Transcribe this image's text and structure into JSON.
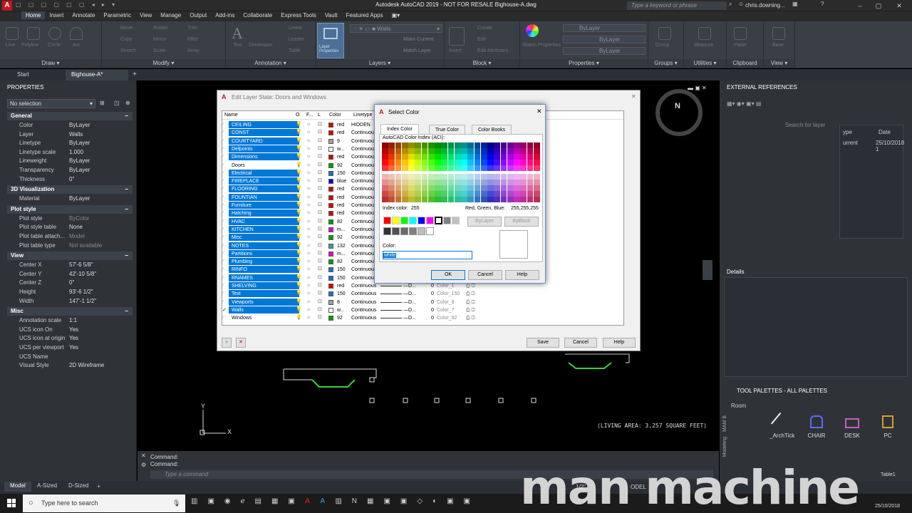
{
  "title_bar": {
    "title": "Autodesk AutoCAD 2019 - NOT FOR RESALE   Bighouse-A.dwg",
    "search_placeholder": "Type a keyword or phrase",
    "user": "chris.downing..."
  },
  "menu": [
    "Home",
    "Insert",
    "Annotate",
    "Parametric",
    "View",
    "Manage",
    "Output",
    "Add-ins",
    "Collaborate",
    "Express Tools",
    "Vault",
    "Featured Apps"
  ],
  "ribbon": {
    "draw": {
      "label": "Draw",
      "tools": [
        "Line",
        "Polyline",
        "Circle",
        "Arc"
      ]
    },
    "modify": {
      "label": "Modify",
      "tools": [
        "Move",
        "Rotate",
        "Trim",
        "Copy",
        "Mirror",
        "Fillet",
        "Stretch",
        "Scale",
        "Array"
      ]
    },
    "annotation": {
      "label": "Annotation",
      "tools": [
        "Text",
        "Dimension",
        "Linear",
        "Leader",
        "Table"
      ]
    },
    "layers": {
      "label": "Layers",
      "current_layer": "Walls",
      "tools": [
        "Layer Properties"
      ]
    },
    "block": {
      "label": "Block",
      "tools": [
        "Create",
        "Edit",
        "Edit Attributes",
        "Insert",
        "Make Current",
        "Match Layer"
      ]
    },
    "properties": {
      "label": "Properties",
      "color": "ByLayer",
      "linetype": "ByLayer",
      "lineweight": "ByLayer",
      "tools": [
        "Match Properties"
      ]
    },
    "groups": {
      "label": "Groups",
      "tools": [
        "Group"
      ]
    },
    "utilities": {
      "label": "Utilities",
      "tools": [
        "Measure"
      ]
    },
    "clipboard": {
      "label": "Clipboard",
      "tools": [
        "Paste"
      ]
    },
    "view": {
      "label": "View",
      "tools": [
        "Base"
      ]
    }
  },
  "doc_tabs": {
    "start": "Start",
    "active": "Bighouse-A*"
  },
  "properties_panel": {
    "title": "PROPERTIES",
    "selection": "No selection",
    "general": {
      "heading": "General",
      "rows": [
        [
          "Color",
          "ByLayer"
        ],
        [
          "Layer",
          "Walls"
        ],
        [
          "Linetype",
          "ByLayer"
        ],
        [
          "Linetype scale",
          "1.000"
        ],
        [
          "Lineweight",
          "ByLayer"
        ],
        [
          "Transparency",
          "ByLayer"
        ],
        [
          "Thickness",
          "0\""
        ]
      ]
    },
    "viz": {
      "heading": "3D Visualization",
      "rows": [
        [
          "Material",
          "ByLayer"
        ]
      ]
    },
    "plot": {
      "heading": "Plot style",
      "rows": [
        [
          "Plot style",
          "ByColor"
        ],
        [
          "Plot style table",
          "None"
        ],
        [
          "Plot table attach...",
          "Model"
        ],
        [
          "Plot table type",
          "Not available"
        ]
      ]
    },
    "view": {
      "heading": "View",
      "rows": [
        [
          "Center X",
          "57'-6 5/8\""
        ],
        [
          "Center Y",
          "42'-10 5/8\""
        ],
        [
          "Center Z",
          "0\""
        ],
        [
          "Height",
          "93'-6 1/2\""
        ],
        [
          "Width",
          "147'-1 1/2\""
        ]
      ]
    },
    "misc": {
      "heading": "Misc",
      "rows": [
        [
          "Annotation scale",
          "1:1"
        ],
        [
          "UCS icon On",
          "Yes"
        ],
        [
          "UCS icon at origin",
          "Yes"
        ],
        [
          "UCS per viewport",
          "Yes"
        ],
        [
          "UCS Name",
          ""
        ],
        [
          "Visual Style",
          "2D Wireframe"
        ]
      ]
    }
  },
  "canvas": {
    "compass": "N",
    "living_area": "(LIVING AREA: 3,257 SQUARE FEET)",
    "axis_x": "X",
    "axis_y": "Y"
  },
  "command": {
    "line1": "Command:",
    "line2": "Command:",
    "placeholder": "Type a command"
  },
  "layer_state_dialog": {
    "title": "Edit Layer State: Doors and Windows",
    "columns": {
      "name": "Name",
      "on": "O",
      "freeze": "F...",
      "lock": "L",
      "color": "Color",
      "linetype": "Linetype"
    },
    "rows": [
      {
        "name": "CEILING",
        "color": "#e00000",
        "cname": "red",
        "lt": "HIDDEN",
        "sel": true
      },
      {
        "name": "CONST",
        "color": "#e00000",
        "cname": "red",
        "lt": "Continuous",
        "sel": true
      },
      {
        "name": "COURTYARD",
        "color": "#a0a0a0",
        "cname": "9",
        "lt": "Continuous",
        "sel": true
      },
      {
        "name": "Defpoints",
        "color": "#ffffff",
        "cname": "w...",
        "lt": "Continuous",
        "sel": true
      },
      {
        "name": "Dimensions",
        "color": "#e00000",
        "cname": "red",
        "lt": "Continuous",
        "sel": true
      },
      {
        "name": "Doors",
        "color": "#00a000",
        "cname": "92",
        "lt": "Continuous",
        "sel": false
      },
      {
        "name": "Electrical",
        "color": "#1e70d0",
        "cname": "150",
        "lt": "Continuous",
        "sel": true
      },
      {
        "name": "FIREPLACE",
        "color": "#0000e0",
        "cname": "blue",
        "lt": "Continuous",
        "sel": true
      },
      {
        "name": "FLOORING",
        "color": "#e00000",
        "cname": "red",
        "lt": "Continuous",
        "sel": true
      },
      {
        "name": "FOUNTIAN",
        "color": "#e00000",
        "cname": "red",
        "lt": "Continuous",
        "sel": true
      },
      {
        "name": "Furniture",
        "color": "#e00000",
        "cname": "red",
        "lt": "Continuous",
        "sel": true
      },
      {
        "name": "Hatching",
        "color": "#e00000",
        "cname": "red",
        "lt": "Continuous",
        "sel": true
      },
      {
        "name": "HVAC",
        "color": "#00a000",
        "cname": "82",
        "lt": "Continuous",
        "sel": true
      },
      {
        "name": "KITCHEN",
        "color": "#e000e0",
        "cname": "m...",
        "lt": "Continuous",
        "sel": true
      },
      {
        "name": "Misc",
        "color": "#00a000",
        "cname": "92",
        "lt": "Continuous",
        "sel": true
      },
      {
        "name": "NOTES",
        "color": "#3aa0a0",
        "cname": "132",
        "lt": "Continuous",
        "sel": true
      },
      {
        "name": "Partitions",
        "color": "#e000e0",
        "cname": "m...",
        "lt": "Continuous",
        "sel": true
      },
      {
        "name": "Plumbing",
        "color": "#00a000",
        "cname": "82",
        "lt": "Continuous",
        "sel": true
      },
      {
        "name": "RINFO",
        "color": "#1e70d0",
        "cname": "150",
        "lt": "Continuous",
        "sel": true
      },
      {
        "name": "RNAMES",
        "color": "#1e70d0",
        "cname": "150",
        "lt": "Continuous",
        "sel": true
      },
      {
        "name": "SHELVING",
        "color": "#e00000",
        "cname": "red",
        "lt": "Continuous",
        "sel": true
      },
      {
        "name": "Text",
        "color": "#1e70d0",
        "cname": "150",
        "lt": "Continuous",
        "sel": true
      },
      {
        "name": "Viewports",
        "color": "#a0a0a0",
        "cname": "8",
        "lt": "Continuous",
        "sel": true
      },
      {
        "name": "Walls",
        "color": "#ffffff",
        "cname": "w...",
        "lt": "Continuous",
        "sel": true
      },
      {
        "name": "Windows",
        "color": "#00a000",
        "cname": "92",
        "lt": "Continuous",
        "sel": false
      }
    ],
    "extra_rows": [
      [
        "0",
        "Color_1"
      ],
      [
        "0",
        "Color_150"
      ],
      [
        "0",
        "Color_8"
      ],
      [
        "0",
        "Color_7"
      ],
      [
        "0",
        "Color_92"
      ]
    ],
    "buttons": {
      "save": "Save",
      "cancel": "Cancel",
      "help": "Help"
    }
  },
  "select_color_dialog": {
    "title": "Select Color",
    "tabs": [
      "Index Color",
      "True Color",
      "Color Books"
    ],
    "aci_label": "AutoCAD Color Index (ACI):",
    "index_color_label": "Index color:",
    "index_color_value": "255",
    "rgb_label": "Red, Green, Blue:",
    "rgb_value": "255,255,255",
    "bylayer": "ByLayer",
    "byblock": "ByBlock",
    "color_label": "Color:",
    "color_value": "white",
    "ok": "OK",
    "cancel": "Cancel",
    "help": "Help"
  },
  "right_panel": {
    "ext_refs": "EXTERNAL REFERENCES",
    "search_placeholder": "Search for layer",
    "col_type": "ype",
    "col_date": "Date",
    "ref_status": "urrent",
    "ref_date": "25/10/2018 1",
    "details": "Details",
    "tool_palettes": "TOOL PALETTES - ALL PALETTES",
    "room": "Room",
    "tools": [
      "_ArchTick",
      "CHAIR",
      "DESK",
      "PC"
    ],
    "side_tabs": [
      "MAM B",
      "Modeling"
    ],
    "table_item": "Table1"
  },
  "layout_tabs": [
    "Model",
    "A-Sized",
    "D-Sized"
  ],
  "status": {
    "scale": "1/2\"",
    "model": "ODEL"
  },
  "taskbar": {
    "search": "Type here to search",
    "date": "25/10/2018"
  },
  "watermark": "man machine"
}
